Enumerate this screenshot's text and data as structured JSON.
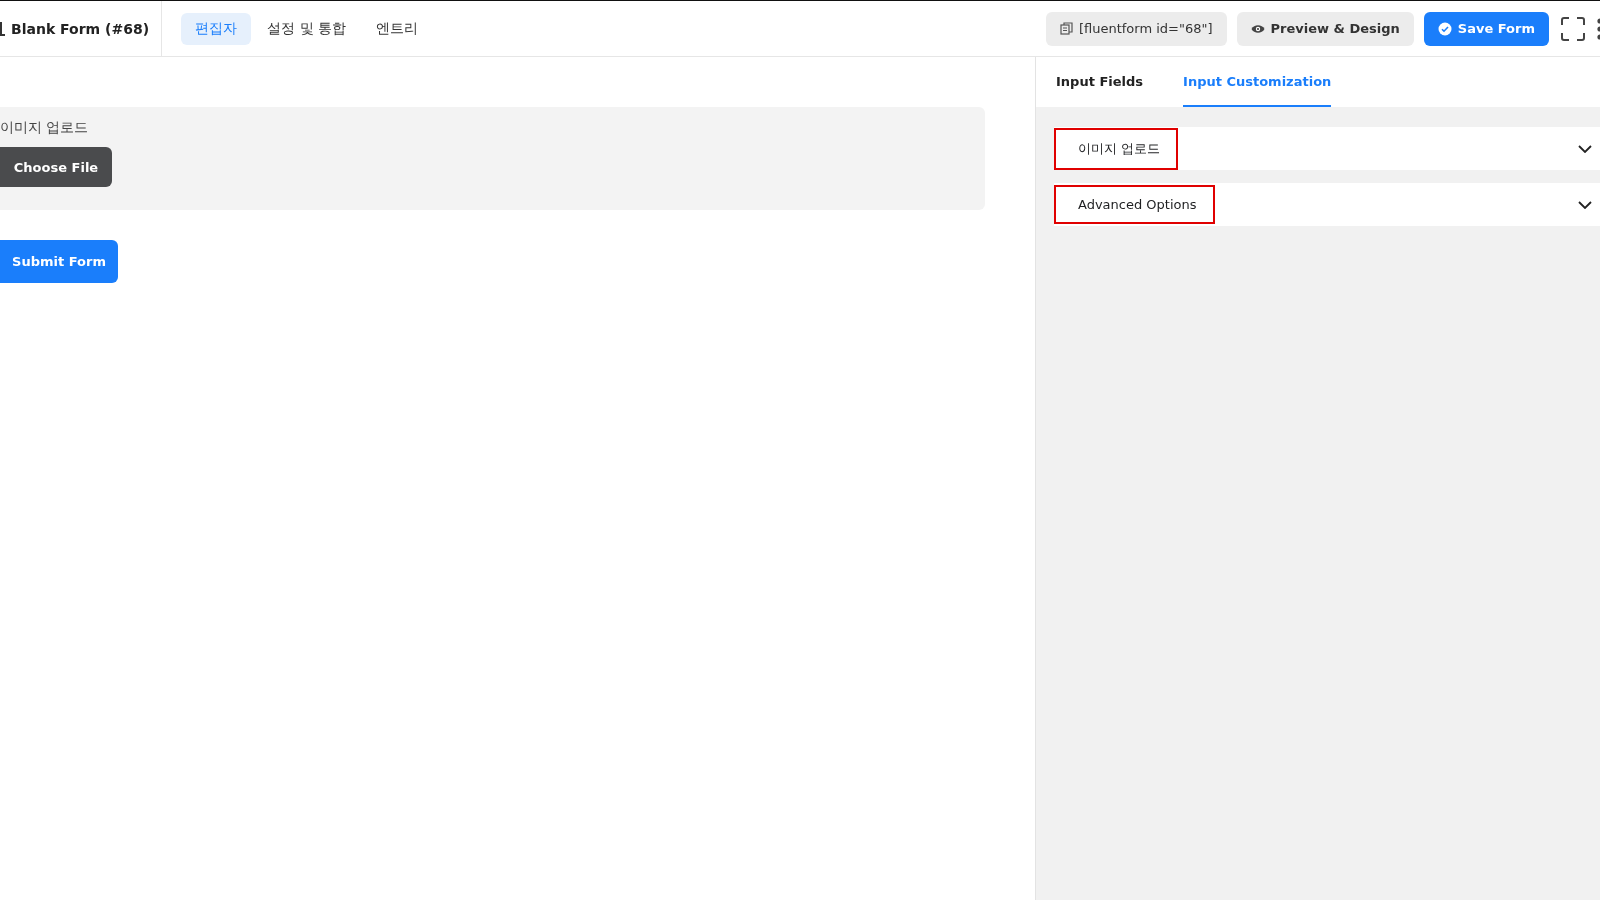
{
  "header": {
    "form_title": "Blank Form (#68)",
    "tabs": [
      {
        "label": "편집자",
        "selected": true
      },
      {
        "label": "설정 및 통합",
        "selected": false
      },
      {
        "label": "엔트리",
        "selected": false
      }
    ],
    "shortcode": "[fluentform id=\"68\"]",
    "preview_button": "Preview & Design",
    "save_button": "Save Form"
  },
  "form": {
    "field_label": "이미지 업로드",
    "file_button": "Choose File",
    "submit_button": "Submit Form"
  },
  "panel": {
    "tabs": [
      {
        "label": "Input Fields",
        "selected": false
      },
      {
        "label": "Input Customization",
        "selected": true
      }
    ],
    "sections": [
      {
        "title": "이미지 업로드",
        "highlighted": true
      },
      {
        "title": "Advanced Options",
        "highlighted": true
      }
    ]
  }
}
